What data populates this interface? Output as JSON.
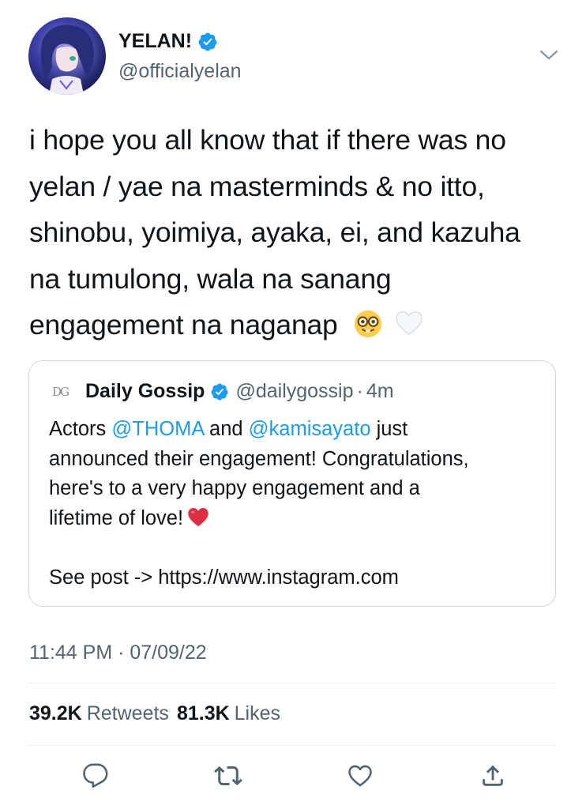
{
  "author": {
    "display_name": "YELAN!",
    "handle": "@officialyelan",
    "verified": true
  },
  "tweet": {
    "text_lines": [
      "i hope you all know that if there was no",
      "yelan / yae na masterminds & no itto,",
      "shinobu, yoimiya, ayaka, ei, and kazuha",
      "na tumulong, wala na sanang",
      "engagement na naganap"
    ],
    "emojis": [
      "nerd-face-emoji",
      "white-heart-emoji"
    ],
    "timestamp": "11:44 PM · 07/09/22"
  },
  "quote": {
    "avatar_text": "DG",
    "display_name": "Daily Gossip",
    "handle": "@dailygossip",
    "dot": "·",
    "time": "4m",
    "body": {
      "prefix": "Actors ",
      "mention1": "@THOMA",
      "mid": " and ",
      "mention2": "@kamisayato",
      "after_line1": " just",
      "line2": "announced their engagement! Congratulations,",
      "line3": "here's to a very happy engagement and a",
      "line4": "lifetime of love!",
      "see_post": "See post -> https://www.instagram.com"
    }
  },
  "stats": {
    "retweets_count": "39.2K",
    "retweets_label": "Retweets",
    "likes_count": "81.3K",
    "likes_label": "Likes"
  },
  "colors": {
    "accent": "#1d9bf0",
    "secondary_text": "#536471",
    "border": "#cfd9de",
    "heart": "#e0245e"
  },
  "actions": [
    "reply-icon",
    "retweet-icon",
    "like-icon",
    "share-icon"
  ]
}
